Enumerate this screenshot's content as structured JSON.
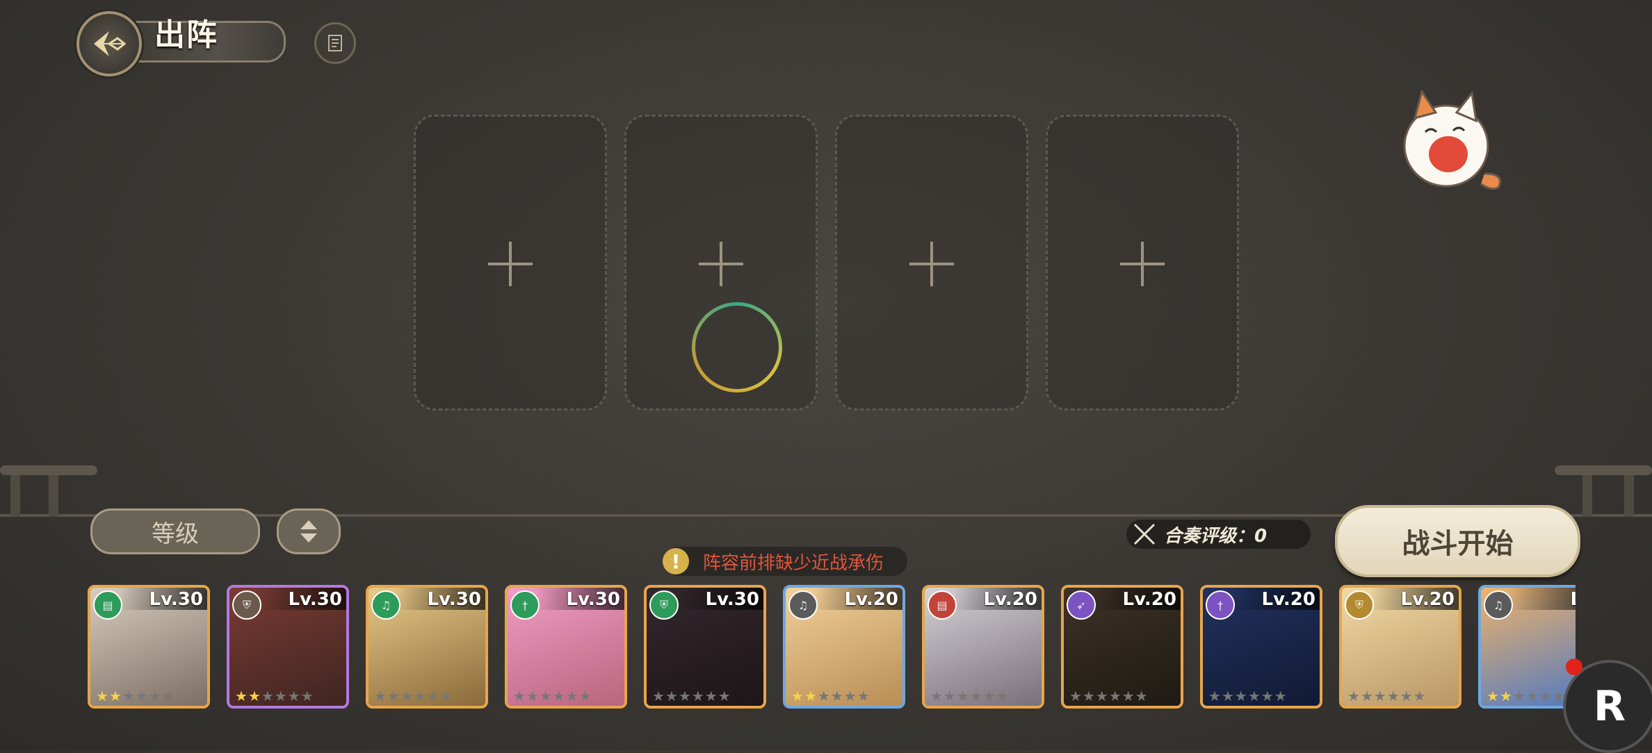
{
  "header": {
    "title": "出阵",
    "back_icon": "compass-emblem-icon",
    "info_icon": "document-icon"
  },
  "slots": [
    "empty",
    "empty",
    "empty",
    "empty"
  ],
  "controls": {
    "sort_label": "等级",
    "warning_text": "阵容前排缺少近战承伤",
    "ensemble_rating": "合奏评级：0",
    "start_button": "战斗开始"
  },
  "characters": [
    {
      "level": "Lv.30",
      "class_icon": "book-icon",
      "class_color": "#2d9b5a",
      "rarity": "gold",
      "stars": 2,
      "portrait": [
        "#d8cdbf",
        "#7d6e63"
      ]
    },
    {
      "level": "Lv.30",
      "class_icon": "shield-icon",
      "class_color": "#6b5a4c",
      "rarity": "purple",
      "stars": 2,
      "portrait": [
        "#7a3b33",
        "#3f2521"
      ]
    },
    {
      "level": "Lv.30",
      "class_icon": "lyre-icon",
      "class_color": "#2d9b5a",
      "rarity": "gold",
      "stars": 0,
      "portrait": [
        "#e7c98a",
        "#8a6a3a"
      ]
    },
    {
      "level": "Lv.30",
      "class_icon": "sword-icon",
      "class_color": "#2d9b5a",
      "rarity": "gold",
      "stars": 0,
      "portrait": [
        "#ef9dc4",
        "#b9657e"
      ]
    },
    {
      "level": "Lv.30",
      "class_icon": "shield-icon",
      "class_color": "#2d9b5a",
      "rarity": "gold",
      "stars": 0,
      "portrait": [
        "#34282d",
        "#1d1518"
      ]
    },
    {
      "level": "Lv.20",
      "class_icon": "lyre-icon",
      "class_color": "#5b5b5b",
      "rarity": "blue",
      "stars": 2,
      "portrait": [
        "#f2d09a",
        "#b98d56"
      ]
    },
    {
      "level": "Lv.20",
      "class_icon": "book-icon",
      "class_color": "#c2433a",
      "rarity": "gold",
      "stars": 0,
      "portrait": [
        "#d4d2d6",
        "#7a6f7a"
      ]
    },
    {
      "level": "Lv.20",
      "class_icon": "bow-icon",
      "class_color": "#7d52c1",
      "rarity": "gold",
      "stars": 0,
      "portrait": [
        "#3d3227",
        "#1f1a14"
      ]
    },
    {
      "level": "Lv.20",
      "class_icon": "sword-icon",
      "class_color": "#7d52c1",
      "rarity": "gold",
      "stars": 0,
      "portrait": [
        "#22325f",
        "#111a33"
      ]
    },
    {
      "level": "Lv.20",
      "class_icon": "shield-icon",
      "class_color": "#b48a2f",
      "rarity": "gold",
      "stars": 0,
      "portrait": [
        "#f1d9a4",
        "#b89766"
      ]
    },
    {
      "level": "Lv",
      "class_icon": "lyre-icon",
      "class_color": "#5b5b5b",
      "rarity": "blue",
      "stars": 2,
      "portrait": [
        "#f0b36a",
        "#4e78c2"
      ]
    }
  ],
  "corner_badge": "R"
}
